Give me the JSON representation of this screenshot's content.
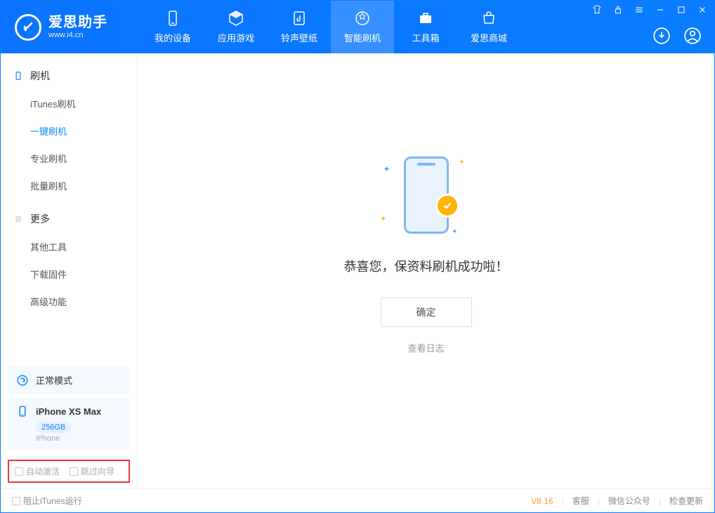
{
  "app": {
    "title": "爱思助手",
    "subtitle": "www.i4.cn"
  },
  "nav": {
    "tabs": [
      {
        "label": "我的设备"
      },
      {
        "label": "应用游戏"
      },
      {
        "label": "铃声壁纸"
      },
      {
        "label": "智能刷机"
      },
      {
        "label": "工具箱"
      },
      {
        "label": "爱思商城"
      }
    ]
  },
  "sidebar": {
    "section1": {
      "header": "刷机",
      "items": [
        "iTunes刷机",
        "一键刷机",
        "专业刷机",
        "批量刷机"
      ]
    },
    "section2": {
      "header": "更多",
      "items": [
        "其他工具",
        "下载固件",
        "高级功能"
      ]
    }
  },
  "status": {
    "mode": "正常模式"
  },
  "device": {
    "name": "iPhone XS Max",
    "storage": "256GB",
    "type": "iPhone"
  },
  "bottom_opts": {
    "auto_activate": "自动激活",
    "skip_guide": "跳过向导"
  },
  "main": {
    "success": "恭喜您，保资料刷机成功啦！",
    "confirm": "确定",
    "view_log": "查看日志"
  },
  "footer": {
    "block_itunes": "阻止iTunes运行",
    "version": "V8.16",
    "links": [
      "客服",
      "微信公众号",
      "检查更新"
    ]
  }
}
